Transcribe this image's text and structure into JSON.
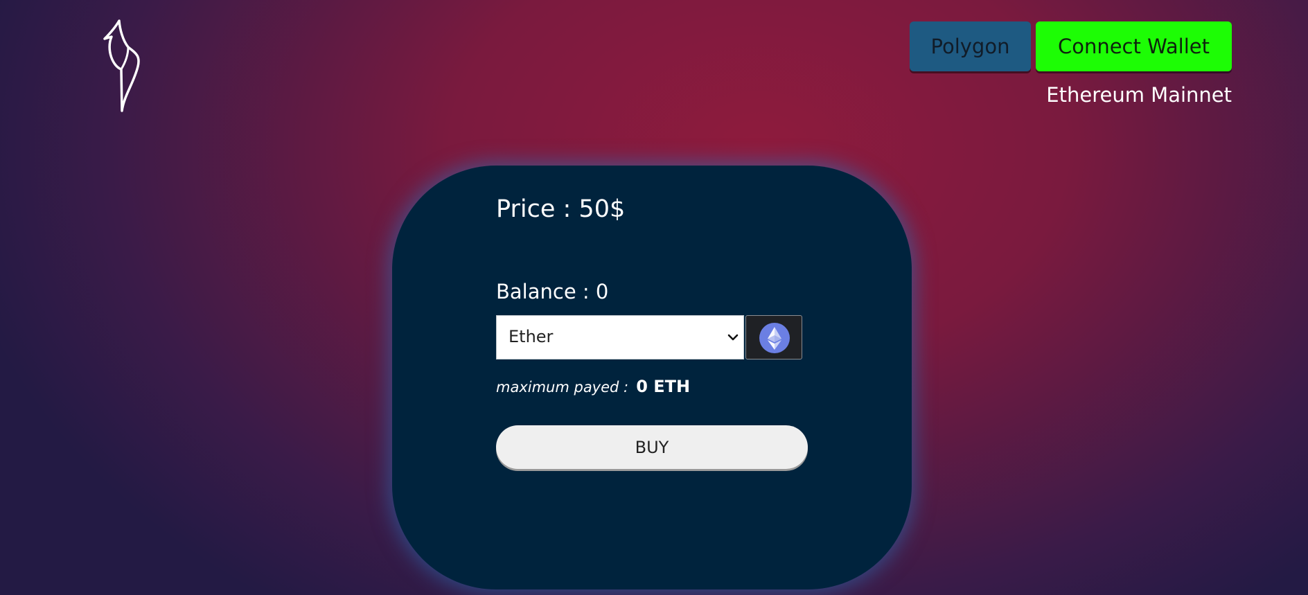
{
  "header": {
    "logo_icon": "bird-logo-icon",
    "network_button_label": "Polygon",
    "connect_button_label": "Connect Wallet",
    "current_network": "Ethereum Mainnet"
  },
  "purchase": {
    "price_text": "Price : 50$",
    "balance_text": "Balance : 0",
    "token_select": {
      "selected": "Ether",
      "icon": "ethereum-icon"
    },
    "max_payed_label": "maximum payed :",
    "max_payed_value": "0 ETH",
    "buy_label": "BUY"
  },
  "colors": {
    "network_button": "#1e5a82",
    "connect_button": "#1dfd05",
    "card_background": "#00233d",
    "background_center": "#8e1b3d",
    "background_edge": "#231a44"
  }
}
